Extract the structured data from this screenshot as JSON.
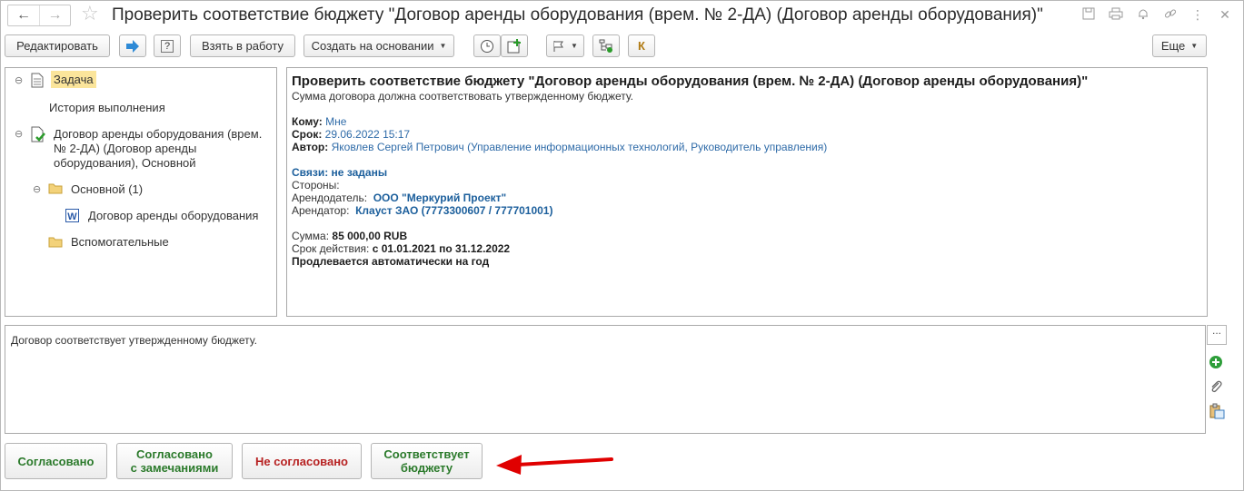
{
  "window": {
    "title": "Проверить соответствие бюджету \"Договор аренды оборудования (врем. № 2-ДА) (Договор аренды оборудования)\"",
    "nav_back": "←",
    "nav_forward": "→"
  },
  "toolbar": {
    "edit": "Редактировать",
    "take": "Взять в работу",
    "create_based": "Создать на основании",
    "k": "К",
    "more": "Еще",
    "help": "?"
  },
  "tree": {
    "task": "Задача",
    "history": "История выполнения",
    "contract_lines": [
      "Договор аренды оборудования (врем.",
      "№ 2-ДА) (Договор аренды",
      "оборудования), Основной"
    ],
    "main_folder": "Основной (1)",
    "file": "Договор аренды оборудования",
    "aux_folder": "Вспомогательные"
  },
  "details": {
    "title": "Проверить соответствие бюджету \"Договор аренды оборудования (врем. № 2-ДА) (Договор аренды оборудования)\"",
    "subtitle": "Сумма договора должна соответствовать утвержденному бюджету.",
    "to_label": "Кому:",
    "to_value": "Мне",
    "due_label": "Срок:",
    "due_value": "29.06.2022 15:17",
    "author_label": "Автор:",
    "author_value": "Яковлев Сергей Петрович (Управление информационных технологий, Руководитель управления)",
    "links": "Связи: не заданы",
    "parties_label": "Стороны:",
    "lessor_label": "Арендодатель:",
    "lessor_value": "ООО \"Меркурий Проект\"",
    "lessee_label": "Арендатор:",
    "lessee_value": "Клауст ЗАО (7773300607 / 777701001)",
    "sum_label": "Сумма:",
    "sum_value": "85 000,00 RUB",
    "period_label": "Срок действия:",
    "period_value": "с 01.01.2021 по 31.12.2022",
    "renewal": "Продлевается автоматически на год"
  },
  "comment": {
    "text": "Договор соответствует утвержденному бюджету.",
    "ellipsis": "..."
  },
  "actions": {
    "approved": "Согласовано",
    "approved_remarks_1": "Согласовано",
    "approved_remarks_2": "с замечаниями",
    "not_approved": "Не согласовано",
    "matches_1": "Соответствует",
    "matches_2": "бюджету"
  },
  "colors": {
    "highlight": "#fbe59b",
    "link": "#2f6ba8",
    "green": "#2b7a2b",
    "red": "#b72222",
    "arrow": "#e00000"
  }
}
